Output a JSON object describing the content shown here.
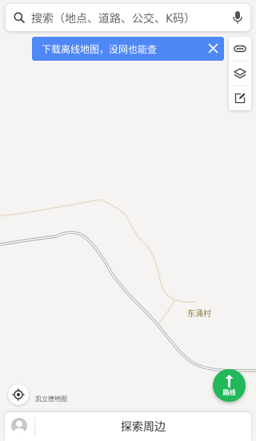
{
  "search": {
    "placeholder": "搜索（地点、道路、公交、K码）",
    "search_icon": "search-icon",
    "voice_icon": "microphone-icon"
  },
  "banner": {
    "text": "下载离线地图，没网也能查",
    "close_icon": "close-icon",
    "color": "#4f87f7"
  },
  "toolbar": {
    "items": [
      {
        "icon": "traffic-icon"
      },
      {
        "icon": "layers-icon"
      },
      {
        "icon": "feedback-edit-icon"
      }
    ]
  },
  "map": {
    "village_label": "东涌村",
    "attribution": "凯立德地图",
    "background_color": "#f5f4f2"
  },
  "controls": {
    "locate_icon": "locate-icon",
    "route_label": "路线",
    "route_color": "#22b85a"
  },
  "bottom": {
    "avatar_icon": "avatar-icon",
    "explore_label": "探索周边"
  }
}
